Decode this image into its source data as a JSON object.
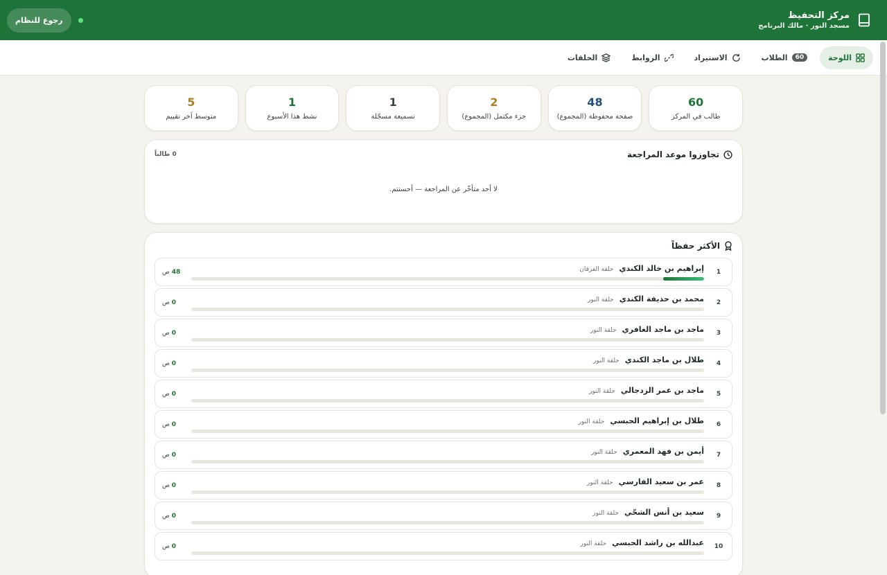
{
  "header": {
    "title": "مركز التحفيظ",
    "subtitle": "مسجد النور · مالك البرنامج",
    "back_label": "رجوع للنظام"
  },
  "nav": {
    "tabs": [
      {
        "label": "اللوحة",
        "icon": "grid-icon",
        "active": true
      },
      {
        "label": "الطلاب",
        "icon": "count-badge",
        "badge": "60"
      },
      {
        "label": "الاستيراد",
        "icon": "refresh-icon"
      },
      {
        "label": "الروابط",
        "icon": "link-icon"
      },
      {
        "label": "الحلقات",
        "icon": "layers-icon"
      }
    ]
  },
  "stats": [
    {
      "value": "60",
      "label": "طالب في المركز",
      "color": "#1e7338"
    },
    {
      "value": "48",
      "label": "صفحة محفوظة (المجموع)",
      "color": "#1f4f7a"
    },
    {
      "value": "2",
      "label": "جزء مكتمل (المجموع)",
      "color": "#b07d1e"
    },
    {
      "value": "1",
      "label": "تسميعة مسجّلة",
      "color": "#3a4540"
    },
    {
      "value": "1",
      "label": "نشط هذا الأسبوع",
      "color": "#1e7338"
    },
    {
      "value": "5",
      "label": "متوسط آخر تقييم",
      "color": "#b07d1e"
    }
  ],
  "overdue": {
    "title": "تجاوزوا موعد المراجعة",
    "count": "0 طالباً",
    "empty_message": "لا أحد متأخّر عن المراجعة — أحسنتم."
  },
  "leaders": {
    "title": "الأكثر حفظاً",
    "unit": "ص",
    "max_pages": 48,
    "rows": [
      {
        "rank": "1",
        "name": "إبراهيم بن خالد الكندي",
        "circle": "حلقة الفرقان",
        "pages": 48,
        "progress": 0.08
      },
      {
        "rank": "2",
        "name": "محمد بن حذيفة الكندي",
        "circle": "حلقة النور",
        "pages": 0,
        "progress": 0
      },
      {
        "rank": "3",
        "name": "ماجد بن ماجد الغافري",
        "circle": "حلقة النور",
        "pages": 0,
        "progress": 0
      },
      {
        "rank": "4",
        "name": "طلال بن ماجد الكندي",
        "circle": "حلقة النور",
        "pages": 0,
        "progress": 0
      },
      {
        "rank": "5",
        "name": "ماجد بن عمر الزدجالي",
        "circle": "حلقة النور",
        "pages": 0,
        "progress": 0
      },
      {
        "rank": "6",
        "name": "طلال بن إبراهيم الحبسي",
        "circle": "حلقة النور",
        "pages": 0,
        "progress": 0
      },
      {
        "rank": "7",
        "name": "أيمن بن فهد المعمري",
        "circle": "حلقة النور",
        "pages": 0,
        "progress": 0
      },
      {
        "rank": "8",
        "name": "عمر بن سعيد الفارسي",
        "circle": "حلقة النور",
        "pages": 0,
        "progress": 0
      },
      {
        "rank": "9",
        "name": "سعيد بن أنس الشحّي",
        "circle": "حلقة النور",
        "pages": 0,
        "progress": 0
      },
      {
        "rank": "10",
        "name": "عبدالله بن راشد الحبسي",
        "circle": "حلقة النور",
        "pages": 0,
        "progress": 0
      }
    ]
  }
}
